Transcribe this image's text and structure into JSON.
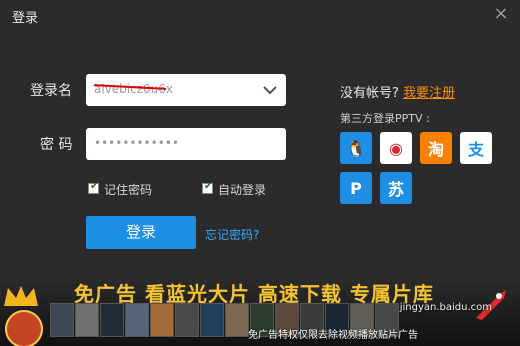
{
  "window": {
    "title": "登录"
  },
  "form": {
    "username_label": "登录名",
    "password_label": "密 码",
    "username_value": "alvebicz0u6x",
    "password_value": "••••••••••••",
    "remember_label": "记住密码",
    "auto_label": "自动登录",
    "login_button": "登录",
    "forgot_link": "忘记密码?"
  },
  "sidebar": {
    "no_account": "没有帐号?",
    "register": "我要注册",
    "third_party": "第三方登录PPTV :",
    "social_icons": [
      {
        "name": "qq-icon",
        "color": "#1e8fe4",
        "glyph": "🐧"
      },
      {
        "name": "weibo-icon",
        "color": "#ffffff",
        "glyph": "◉"
      },
      {
        "name": "taobao-icon",
        "color": "#ff7f00",
        "glyph": "淘"
      },
      {
        "name": "alipay-icon",
        "color": "#ffffff",
        "glyph": "支"
      },
      {
        "name": "pptv-p-icon",
        "color": "#1e8fe4",
        "glyph": "P"
      },
      {
        "name": "suning-icon",
        "color": "#1e8fe4",
        "glyph": "苏"
      }
    ]
  },
  "banner": {
    "headline": "免广告  看蓝光大片  高速下载  专属片库",
    "notice": "免广告特权仅限去除视频播放贴片广告",
    "watermark": "jingyan.baidu.com"
  }
}
